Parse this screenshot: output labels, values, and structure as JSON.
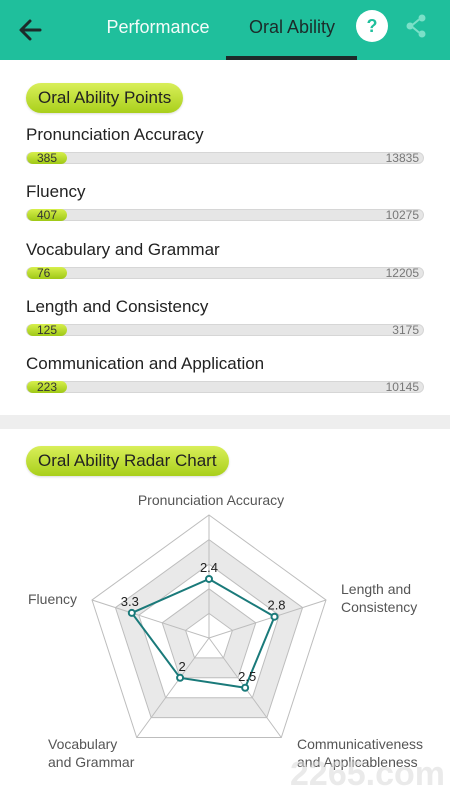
{
  "header": {
    "tabs": [
      {
        "label": "Performance"
      },
      {
        "label": "Oral Ability"
      }
    ],
    "help_label": "?"
  },
  "points_section": {
    "title": "Oral Ability Points",
    "metrics": [
      {
        "label": "Pronunciation Accuracy",
        "value": "385",
        "max": "13835",
        "fill": 0.028
      },
      {
        "label": "Fluency",
        "value": "407",
        "max": "10275",
        "fill": 0.04
      },
      {
        "label": "Vocabulary and Grammar",
        "value": "76",
        "max": "12205",
        "fill": 0.006
      },
      {
        "label": "Length and Consistency",
        "value": "125",
        "max": "3175",
        "fill": 0.039
      },
      {
        "label": "Communication and Application",
        "value": "223",
        "max": "10145",
        "fill": 0.022
      }
    ]
  },
  "radar_section": {
    "title": "Oral Ability Radar Chart"
  },
  "chart_data": {
    "type": "radar",
    "axes": [
      {
        "label": "Pronunciation Accuracy",
        "value": 2.4
      },
      {
        "label": "Length and Consistency",
        "value": 2.8
      },
      {
        "label": "Communicativeness and Applicableness",
        "value": 2.5
      },
      {
        "label": "Vocabulary and Grammar",
        "value": 2
      },
      {
        "label": "Fluency",
        "value": 3.3
      }
    ],
    "value_labels": [
      "2.4",
      "2.8",
      "2.5",
      "2",
      "3.3"
    ],
    "axis_label_lines": [
      [
        "Pronunciation Accuracy"
      ],
      [
        "Length and",
        "Consistency"
      ],
      [
        "Communicativeness",
        "and Applicableness"
      ],
      [
        "Vocabulary",
        "and Grammar"
      ],
      [
        "Fluency"
      ]
    ],
    "rings": 5,
    "max": 5,
    "colors": {
      "series": "#1a7a7a",
      "band": "#e9e9e9",
      "grid": "#bdbdbd"
    }
  },
  "watermark": {
    "text": "2265.com"
  }
}
